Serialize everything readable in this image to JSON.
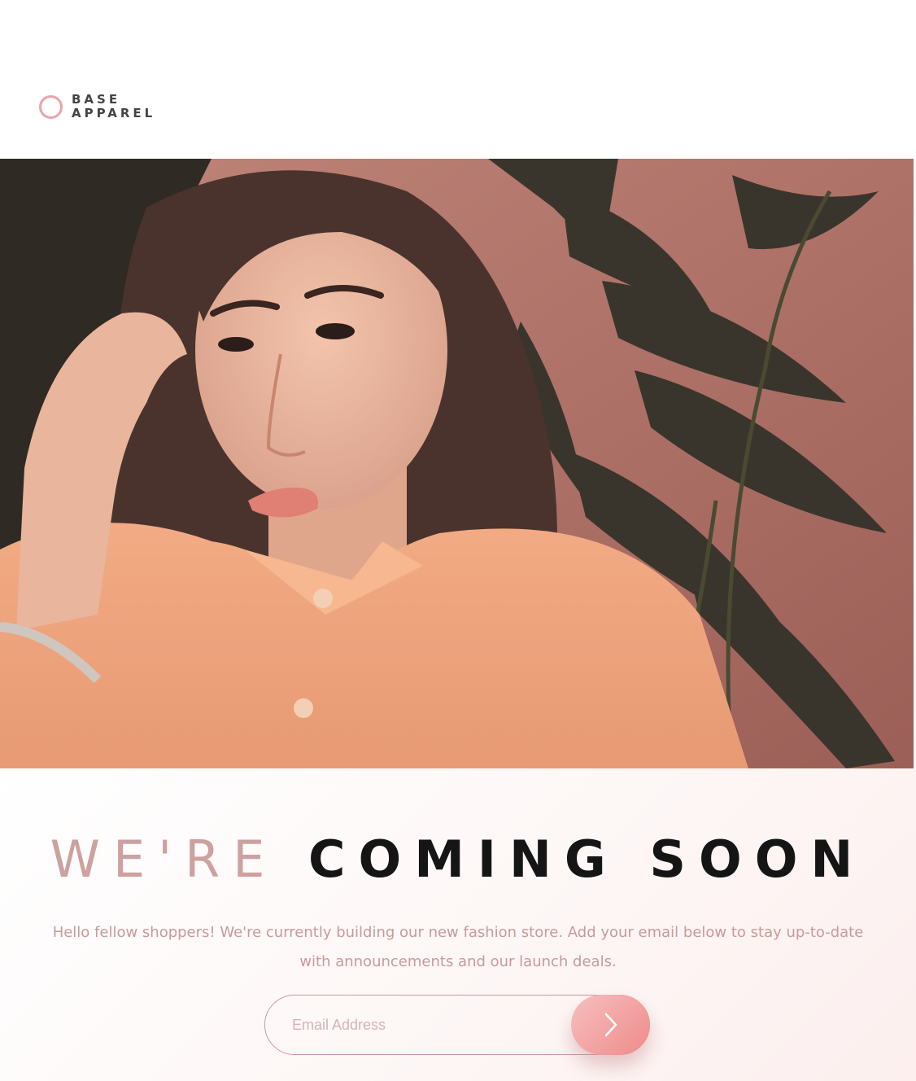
{
  "brand": {
    "line1": "BASE",
    "line2": "APPAREL",
    "accent_color": "#eaa5a8",
    "logo_icon": "ring-icon"
  },
  "hero": {
    "image_subject": "woman in peach shirt in front of plant and pink wall"
  },
  "headline": {
    "light": "WE'RE",
    "bold": "COMING SOON"
  },
  "description": "Hello fellow shoppers! We're currently building our new fashion store. Add your email below to stay up-to-date with announcements and our launch deals.",
  "form": {
    "email_placeholder": "Email Address",
    "email_value": "",
    "submit_icon": "chevron-right-icon"
  },
  "colors": {
    "text_light": "#cea1a1",
    "text_dark": "#151515",
    "paragraph": "#c99a9a",
    "button_gradient_start": "#f8bfbf",
    "button_gradient_end": "#ee8b8b"
  }
}
